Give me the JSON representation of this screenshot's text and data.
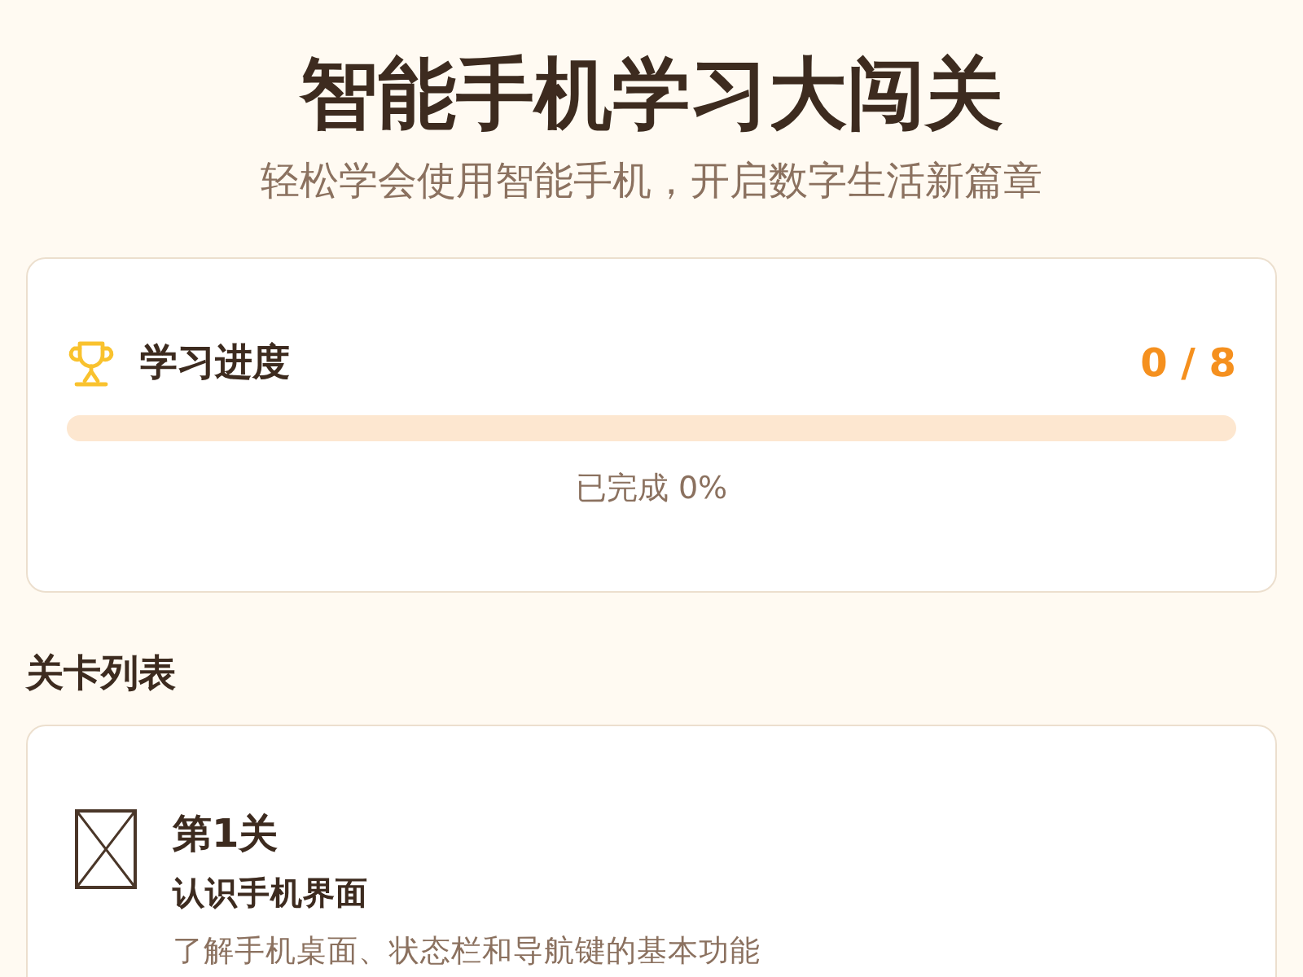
{
  "header": {
    "title": "智能手机学习大闯关",
    "subtitle": "轻松学会使用智能手机，开启数字生活新篇章"
  },
  "progress": {
    "title": "学习进度",
    "count": "0 / 8",
    "level": 0,
    "caption": "已完成 0%"
  },
  "levels_section": {
    "title": "关卡列表",
    "levels": [
      {
        "number": "第1关",
        "name": "认识手机界面",
        "description": "了解手机桌面、状态栏和导航键的基本功能"
      }
    ]
  }
}
